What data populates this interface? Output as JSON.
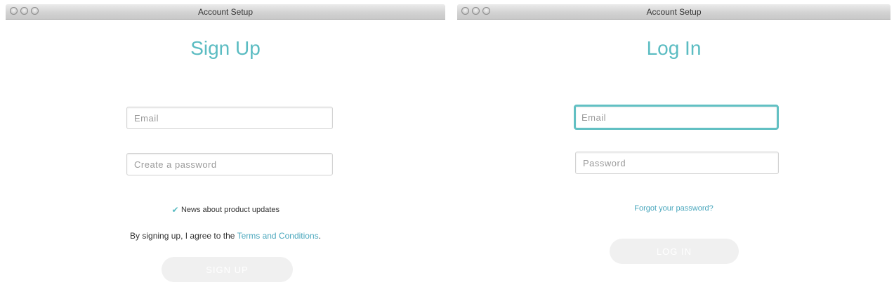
{
  "signup_window": {
    "title": "Account Setup",
    "heading": "Sign Up",
    "email_placeholder": "Email",
    "password_placeholder": "Create a password",
    "news_label": "News about product updates",
    "news_checked": true,
    "terms_prefix": "By signing up, I agree to the ",
    "terms_link": "Terms and Conditions",
    "terms_suffix": ".",
    "button_label": "SIGN UP"
  },
  "login_window": {
    "title": "Account Setup",
    "heading": "Log In",
    "email_placeholder": "Email",
    "password_placeholder": "Password",
    "forgot_label": "Forgot your password?",
    "button_label": "LOG IN"
  },
  "colors": {
    "accent": "#5bbcc2",
    "link": "#4aa7bd",
    "button_disabled_bg": "#f0f0f0"
  }
}
